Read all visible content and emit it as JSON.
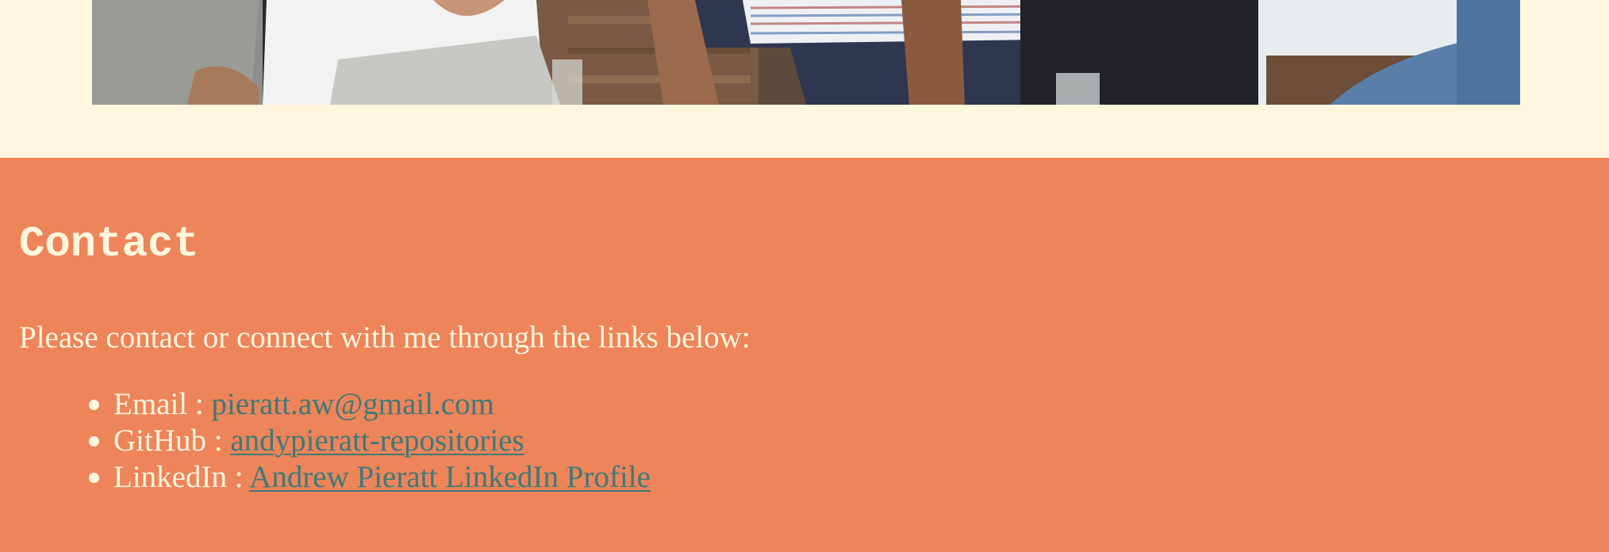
{
  "contact": {
    "title": "Contact",
    "intro": "Please contact or connect with me through the links below:",
    "items": [
      {
        "label": "Email :",
        "link_text": "pieratt.aw@gmail.com"
      },
      {
        "label": "GitHub :",
        "link_text": "andypieratt-repositories"
      },
      {
        "label": "LinkedIn :",
        "link_text": "Andrew Pieratt LinkedIn Profile"
      }
    ]
  },
  "colors": {
    "page_background": "#fef6dd",
    "contact_background": "#ee845a",
    "text": "#fef6dd",
    "link": "#3d7a78"
  }
}
